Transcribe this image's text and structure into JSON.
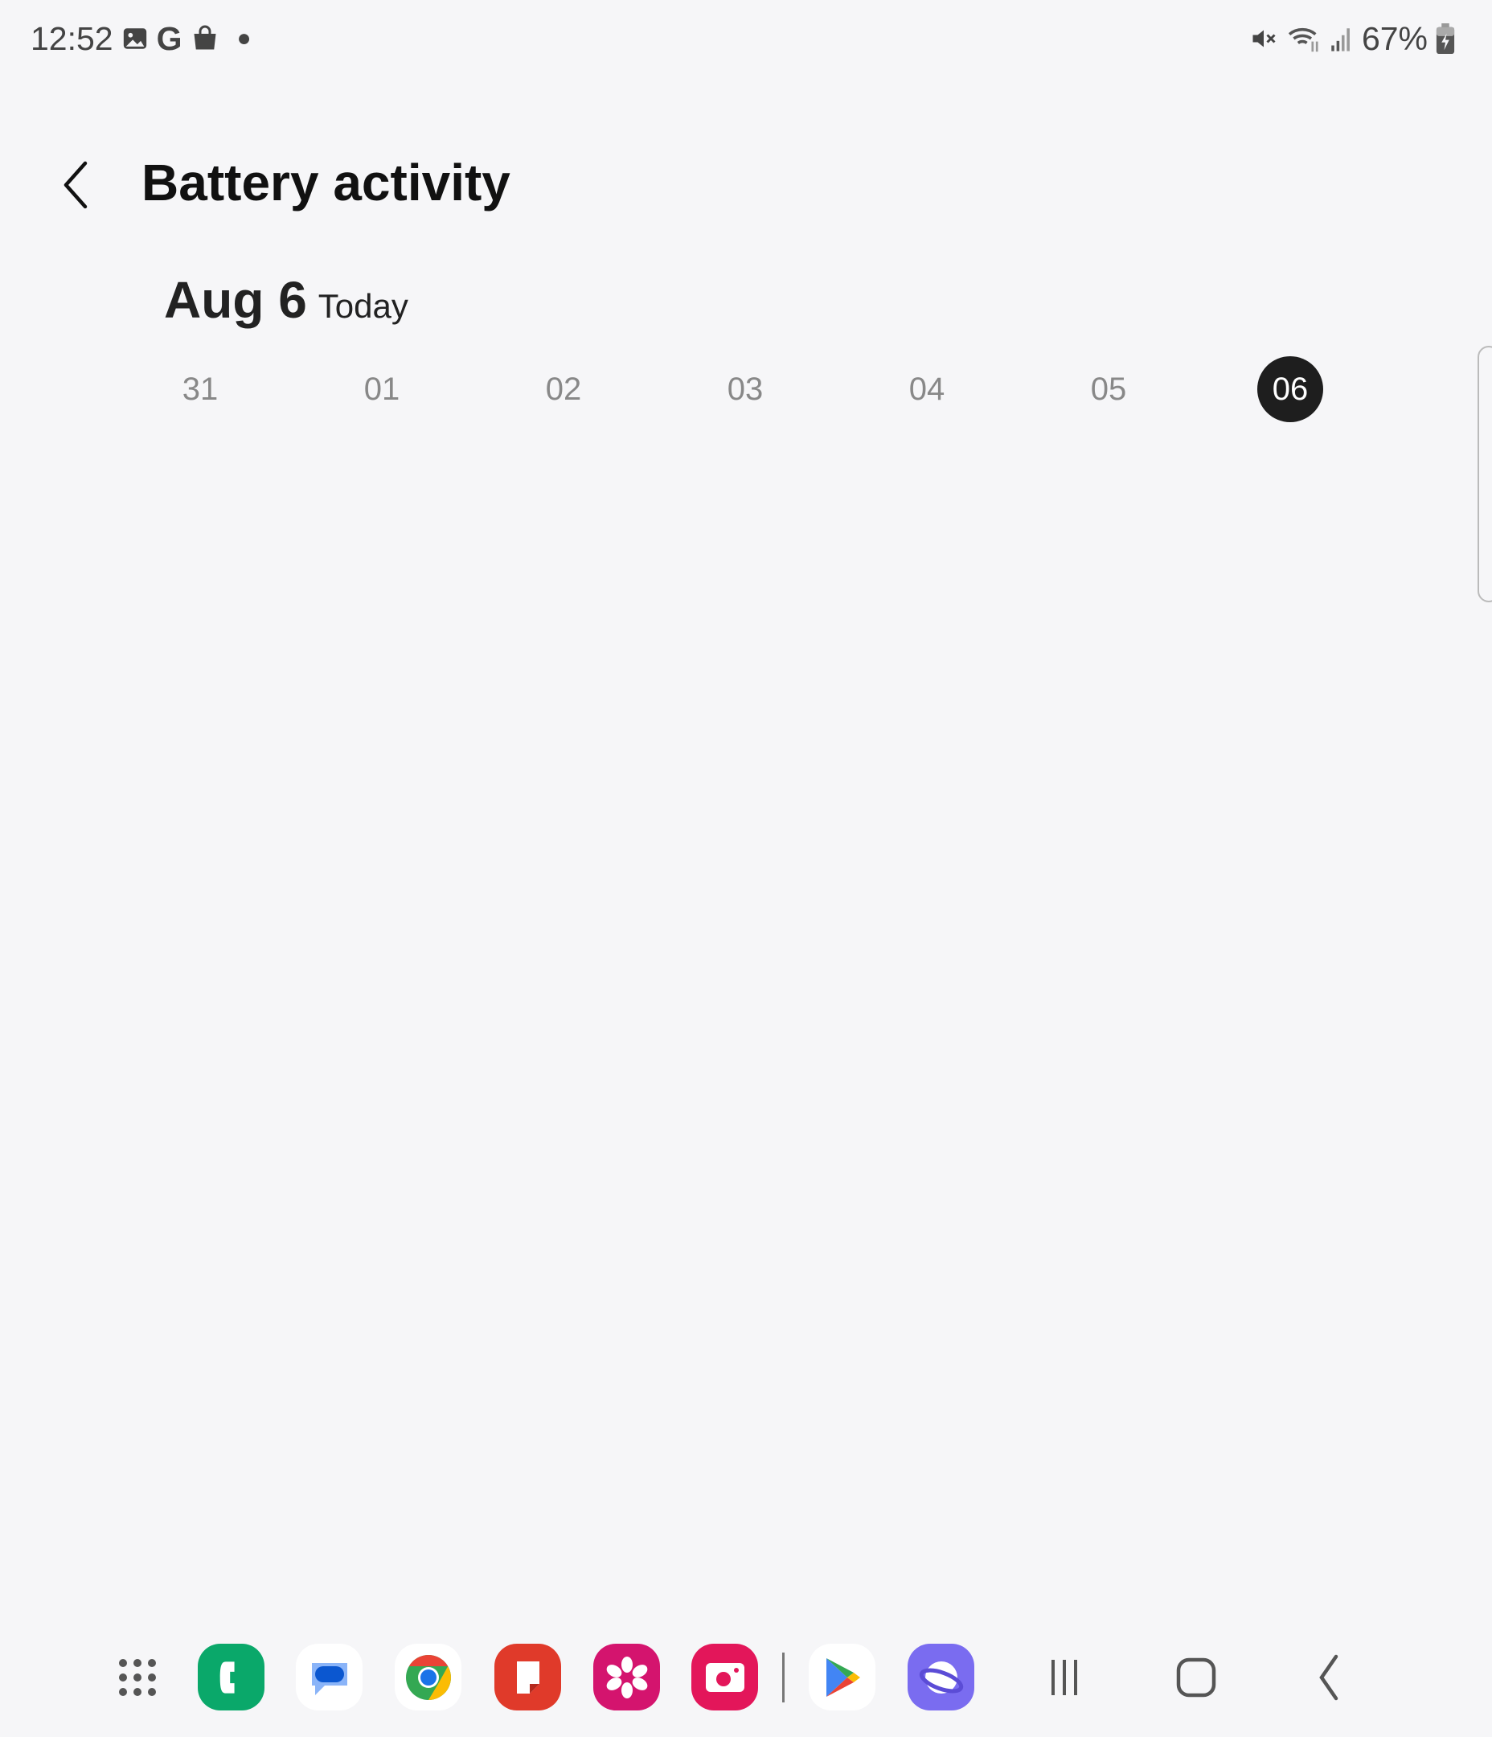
{
  "status_bar": {
    "time": "12:52",
    "battery": "67%",
    "left_icons": [
      "gallery-icon",
      "google-icon",
      "shopping-bag-icon",
      "dot-icon"
    ],
    "right_icons": [
      "mute-icon",
      "wifi-icon",
      "signal-icon",
      "battery-charging-icon"
    ]
  },
  "header": {
    "title": "Battery activity"
  },
  "date": {
    "label": "Aug 6",
    "sub": "Today"
  },
  "days": [
    "31",
    "01",
    "02",
    "03",
    "04",
    "05",
    "06"
  ],
  "selected_day": "06",
  "dock": {
    "apps": [
      "Phone",
      "Messages",
      "Chrome",
      "Notes",
      "Gallery",
      "Camera",
      "Play Store",
      "Internet"
    ]
  }
}
